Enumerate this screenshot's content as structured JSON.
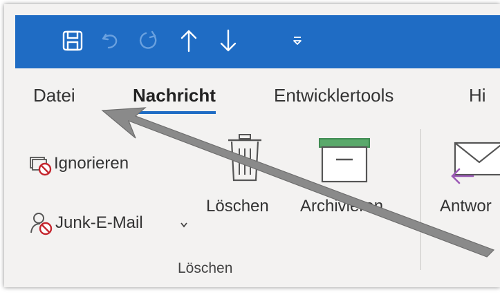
{
  "quick_access": {
    "items": [
      {
        "icon": "save-icon"
      },
      {
        "icon": "undo-icon"
      },
      {
        "icon": "redo-icon"
      },
      {
        "icon": "arrow-up-icon"
      },
      {
        "icon": "arrow-down-icon"
      },
      {
        "icon": "customize-dropdown-icon"
      }
    ],
    "accent_color": "#1f6cc4"
  },
  "tabs": [
    {
      "label": "Datei",
      "active": false
    },
    {
      "label": "Nachricht",
      "active": true
    },
    {
      "label": "Entwicklertools",
      "active": false
    },
    {
      "label": "Hi",
      "active": false
    }
  ],
  "ribbon": {
    "delete_group": {
      "ignore_label": "Ignorieren",
      "junk_label": "Junk-E-Mail",
      "delete_label": "Löschen",
      "archive_label": "Archivieren",
      "group_label": "Löschen"
    },
    "respond_group": {
      "reply_label": "Antwor"
    }
  },
  "colors": {
    "accent": "#1f6cc4",
    "delete_red": "#c4262e",
    "archive_green": "#5aa96b",
    "reply_purple": "#9b59b6",
    "annotation_arrow": "#8a8a8a"
  }
}
